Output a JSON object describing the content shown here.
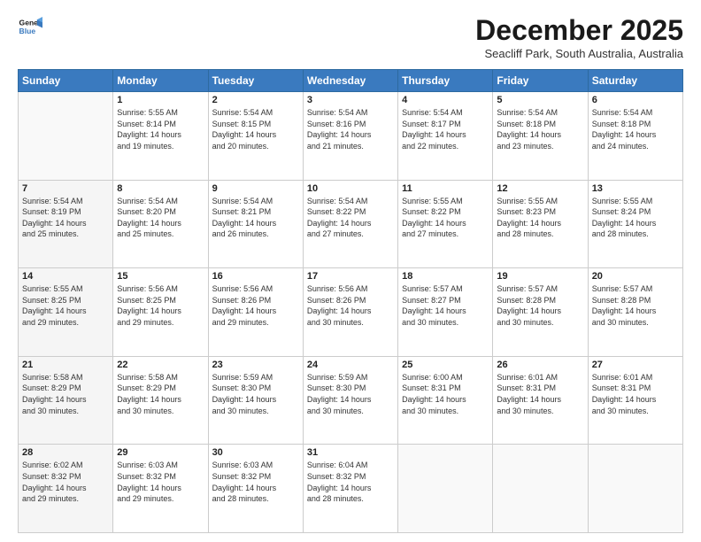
{
  "logo": {
    "line1": "General",
    "line2": "Blue"
  },
  "title": "December 2025",
  "location": "Seacliff Park, South Australia, Australia",
  "header_days": [
    "Sunday",
    "Monday",
    "Tuesday",
    "Wednesday",
    "Thursday",
    "Friday",
    "Saturday"
  ],
  "weeks": [
    [
      {
        "num": "",
        "info": ""
      },
      {
        "num": "1",
        "info": "Sunrise: 5:55 AM\nSunset: 8:14 PM\nDaylight: 14 hours\nand 19 minutes."
      },
      {
        "num": "2",
        "info": "Sunrise: 5:54 AM\nSunset: 8:15 PM\nDaylight: 14 hours\nand 20 minutes."
      },
      {
        "num": "3",
        "info": "Sunrise: 5:54 AM\nSunset: 8:16 PM\nDaylight: 14 hours\nand 21 minutes."
      },
      {
        "num": "4",
        "info": "Sunrise: 5:54 AM\nSunset: 8:17 PM\nDaylight: 14 hours\nand 22 minutes."
      },
      {
        "num": "5",
        "info": "Sunrise: 5:54 AM\nSunset: 8:18 PM\nDaylight: 14 hours\nand 23 minutes."
      },
      {
        "num": "6",
        "info": "Sunrise: 5:54 AM\nSunset: 8:18 PM\nDaylight: 14 hours\nand 24 minutes."
      }
    ],
    [
      {
        "num": "7",
        "info": "Sunrise: 5:54 AM\nSunset: 8:19 PM\nDaylight: 14 hours\nand 25 minutes."
      },
      {
        "num": "8",
        "info": "Sunrise: 5:54 AM\nSunset: 8:20 PM\nDaylight: 14 hours\nand 25 minutes."
      },
      {
        "num": "9",
        "info": "Sunrise: 5:54 AM\nSunset: 8:21 PM\nDaylight: 14 hours\nand 26 minutes."
      },
      {
        "num": "10",
        "info": "Sunrise: 5:54 AM\nSunset: 8:22 PM\nDaylight: 14 hours\nand 27 minutes."
      },
      {
        "num": "11",
        "info": "Sunrise: 5:55 AM\nSunset: 8:22 PM\nDaylight: 14 hours\nand 27 minutes."
      },
      {
        "num": "12",
        "info": "Sunrise: 5:55 AM\nSunset: 8:23 PM\nDaylight: 14 hours\nand 28 minutes."
      },
      {
        "num": "13",
        "info": "Sunrise: 5:55 AM\nSunset: 8:24 PM\nDaylight: 14 hours\nand 28 minutes."
      }
    ],
    [
      {
        "num": "14",
        "info": "Sunrise: 5:55 AM\nSunset: 8:25 PM\nDaylight: 14 hours\nand 29 minutes."
      },
      {
        "num": "15",
        "info": "Sunrise: 5:56 AM\nSunset: 8:25 PM\nDaylight: 14 hours\nand 29 minutes."
      },
      {
        "num": "16",
        "info": "Sunrise: 5:56 AM\nSunset: 8:26 PM\nDaylight: 14 hours\nand 29 minutes."
      },
      {
        "num": "17",
        "info": "Sunrise: 5:56 AM\nSunset: 8:26 PM\nDaylight: 14 hours\nand 30 minutes."
      },
      {
        "num": "18",
        "info": "Sunrise: 5:57 AM\nSunset: 8:27 PM\nDaylight: 14 hours\nand 30 minutes."
      },
      {
        "num": "19",
        "info": "Sunrise: 5:57 AM\nSunset: 8:28 PM\nDaylight: 14 hours\nand 30 minutes."
      },
      {
        "num": "20",
        "info": "Sunrise: 5:57 AM\nSunset: 8:28 PM\nDaylight: 14 hours\nand 30 minutes."
      }
    ],
    [
      {
        "num": "21",
        "info": "Sunrise: 5:58 AM\nSunset: 8:29 PM\nDaylight: 14 hours\nand 30 minutes."
      },
      {
        "num": "22",
        "info": "Sunrise: 5:58 AM\nSunset: 8:29 PM\nDaylight: 14 hours\nand 30 minutes."
      },
      {
        "num": "23",
        "info": "Sunrise: 5:59 AM\nSunset: 8:30 PM\nDaylight: 14 hours\nand 30 minutes."
      },
      {
        "num": "24",
        "info": "Sunrise: 5:59 AM\nSunset: 8:30 PM\nDaylight: 14 hours\nand 30 minutes."
      },
      {
        "num": "25",
        "info": "Sunrise: 6:00 AM\nSunset: 8:31 PM\nDaylight: 14 hours\nand 30 minutes."
      },
      {
        "num": "26",
        "info": "Sunrise: 6:01 AM\nSunset: 8:31 PM\nDaylight: 14 hours\nand 30 minutes."
      },
      {
        "num": "27",
        "info": "Sunrise: 6:01 AM\nSunset: 8:31 PM\nDaylight: 14 hours\nand 30 minutes."
      }
    ],
    [
      {
        "num": "28",
        "info": "Sunrise: 6:02 AM\nSunset: 8:32 PM\nDaylight: 14 hours\nand 29 minutes."
      },
      {
        "num": "29",
        "info": "Sunrise: 6:03 AM\nSunset: 8:32 PM\nDaylight: 14 hours\nand 29 minutes."
      },
      {
        "num": "30",
        "info": "Sunrise: 6:03 AM\nSunset: 8:32 PM\nDaylight: 14 hours\nand 28 minutes."
      },
      {
        "num": "31",
        "info": "Sunrise: 6:04 AM\nSunset: 8:32 PM\nDaylight: 14 hours\nand 28 minutes."
      },
      {
        "num": "",
        "info": ""
      },
      {
        "num": "",
        "info": ""
      },
      {
        "num": "",
        "info": ""
      }
    ]
  ]
}
